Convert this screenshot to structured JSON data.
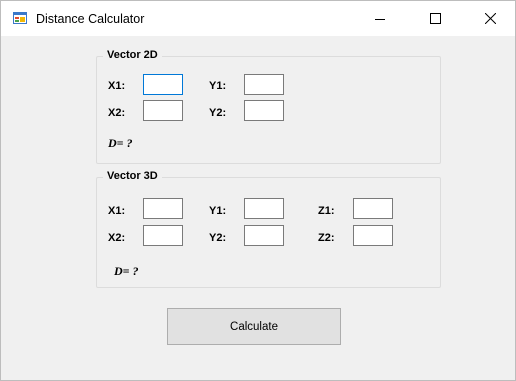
{
  "window": {
    "title": "Distance Calculator"
  },
  "vector2d": {
    "legend": "Vector 2D",
    "x1_label": "X1:",
    "y1_label": "Y1:",
    "x2_label": "X2:",
    "y2_label": "Y2:",
    "x1_value": "",
    "y1_value": "",
    "x2_value": "",
    "y2_value": "",
    "result": "D= ?"
  },
  "vector3d": {
    "legend": "Vector 3D",
    "x1_label": "X1:",
    "y1_label": "Y1:",
    "z1_label": "Z1:",
    "x2_label": "X2:",
    "y2_label": "Y2:",
    "z2_label": "Z2:",
    "x1_value": "",
    "y1_value": "",
    "z1_value": "",
    "x2_value": "",
    "y2_value": "",
    "z2_value": "",
    "result": "D= ?"
  },
  "calculate_label": "Calculate",
  "icons": {
    "app": "window-app-icon",
    "minimize": "minimize-icon",
    "maximize": "maximize-icon",
    "close": "close-icon"
  },
  "colors": {
    "focus_border": "#0078d7",
    "form_background": "#f0f0f0",
    "button_background": "#e1e1e1"
  }
}
